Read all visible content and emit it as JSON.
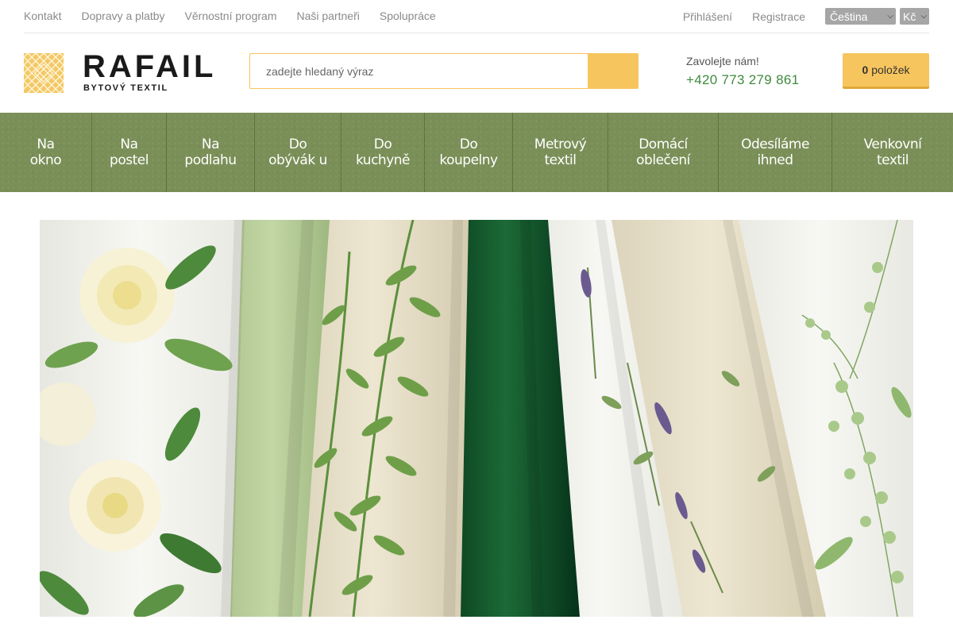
{
  "topbar": {
    "links": [
      "Kontakt",
      "Dopravy a platby",
      "Věrnostní program",
      "Naši partneři",
      "Spolupráce"
    ],
    "login": "Přihlášení",
    "register": "Registrace",
    "language": "Čeština",
    "currency": "Kč"
  },
  "logo": {
    "name": "RAFAIL",
    "subtitle": "BYTOVÝ TEXTIL"
  },
  "search": {
    "placeholder": "zadejte hledaný výraz",
    "icon": "search-icon"
  },
  "contact": {
    "label": "Zavolejte nám!",
    "phone": "+420 773 279 861"
  },
  "cart": {
    "count": "0",
    "label": "položek"
  },
  "nav": {
    "items": [
      "Na\nokno",
      "Na\npostel",
      "Na\npodlahu",
      "Do\nobývák u",
      "Do\nkuchyně",
      "Do\nkoupelny",
      "Metrový\ntextil",
      "Domácí\noblečení",
      "Odesíláme\nihned",
      "Venkovní\ntextil"
    ]
  },
  "colors": {
    "accent": "#f7c55e",
    "nav_bg": "#7a8f57",
    "phone": "#3e8a3e",
    "link": "#8a8a8a"
  }
}
